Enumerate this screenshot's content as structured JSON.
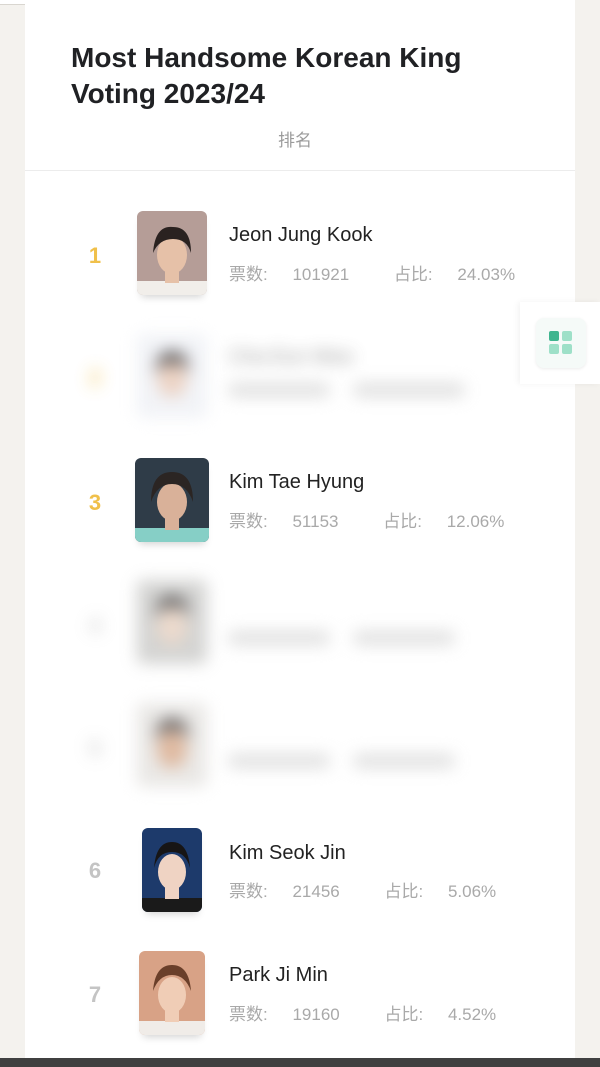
{
  "header": {
    "title": "Most Handsome Korean King Voting 2023/24",
    "subtitle": "排名"
  },
  "labels": {
    "votes": "票数:",
    "share": "占比:"
  },
  "rows": [
    {
      "rank": "1",
      "name": "Jeon Jung Kook",
      "votes": "101921",
      "share": "24.03%",
      "blurred": false
    },
    {
      "rank": "2",
      "name": "Cha Eun Woo",
      "votes": "",
      "share": "",
      "blurred": true
    },
    {
      "rank": "3",
      "name": "Kim Tae Hyung",
      "votes": "51153",
      "share": "12.06%",
      "blurred": false
    },
    {
      "rank": "4",
      "name": "",
      "votes": "",
      "share": "",
      "blurred": true
    },
    {
      "rank": "5",
      "name": "",
      "votes": "",
      "share": "",
      "blurred": true
    },
    {
      "rank": "6",
      "name": "Kim Seok Jin",
      "votes": "21456",
      "share": "5.06%",
      "blurred": false
    },
    {
      "rank": "7",
      "name": "Park Ji Min",
      "votes": "19160",
      "share": "4.52%",
      "blurred": false
    }
  ],
  "colors": {
    "gold": "#f0c04a",
    "grey": "#c4c4c4",
    "accent": "#3fb58f"
  }
}
